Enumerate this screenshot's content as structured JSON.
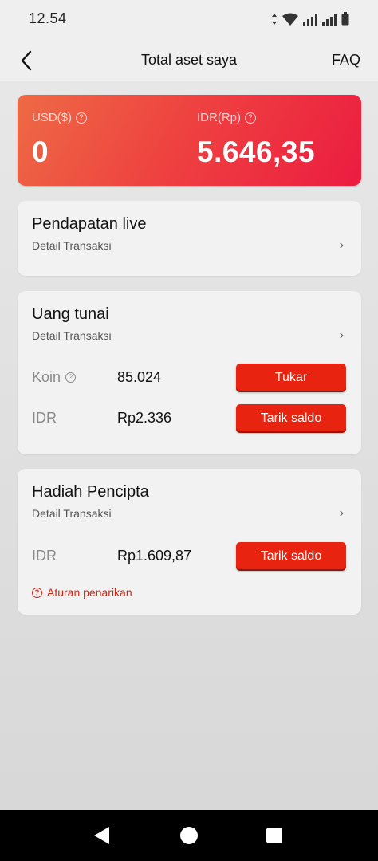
{
  "status_bar": {
    "time": "12.54"
  },
  "header": {
    "title": "Total aset saya",
    "faq": "FAQ"
  },
  "balance": {
    "usd_label": "USD($)",
    "usd_value": "0",
    "idr_label": "IDR(Rp)",
    "idr_value": "5.646,35"
  },
  "live_income": {
    "title": "Pendapatan live",
    "detail": "Detail Transaksi"
  },
  "cash": {
    "title": "Uang tunai",
    "detail": "Detail Transaksi",
    "coin_label": "Koin",
    "coin_value": "85.024",
    "exchange_button": "Tukar",
    "idr_label": "IDR",
    "idr_value": "Rp2.336",
    "withdraw_button": "Tarik saldo"
  },
  "creator_reward": {
    "title": "Hadiah Pencipta",
    "detail": "Detail Transaksi",
    "idr_label": "IDR",
    "idr_value": "Rp1.609,87",
    "withdraw_button": "Tarik saldo",
    "rules_link": "Aturan penarikan"
  },
  "colors": {
    "accent_red": "#e8230f",
    "card_gradient_start": "#ee6a45",
    "card_gradient_end": "#ec1c40"
  }
}
